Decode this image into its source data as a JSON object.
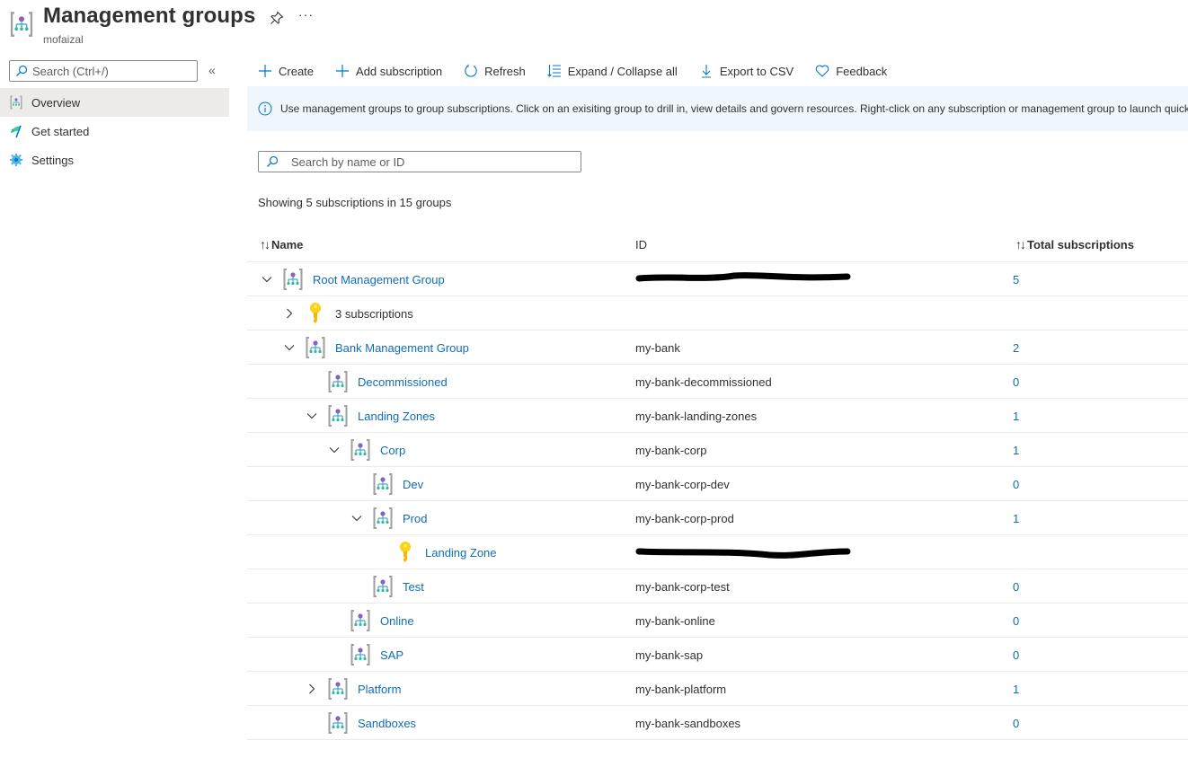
{
  "header": {
    "title": "Management groups",
    "subtitle": "mofaizal",
    "more_label": "···"
  },
  "sidebar": {
    "search_placeholder": "Search (Ctrl+/)",
    "collapse_label": "«",
    "items": [
      {
        "label": "Overview",
        "icon": "management-group-icon",
        "active": true
      },
      {
        "label": "Get started",
        "icon": "flag-icon",
        "active": false
      },
      {
        "label": "Settings",
        "icon": "gear-icon",
        "active": false
      }
    ]
  },
  "toolbar": {
    "create": "Create",
    "add_subscription": "Add subscription",
    "refresh": "Refresh",
    "expand_collapse": "Expand / Collapse all",
    "export_csv": "Export to CSV",
    "feedback": "Feedback"
  },
  "info": {
    "text": "Use management groups to group subscriptions. Click on an exisiting group to drill in, view details and govern resources. Right-click on any subscription or management group to launch quick"
  },
  "filter": {
    "search_placeholder": "Search by name or ID",
    "count_text": "Showing 5 subscriptions in 15 groups"
  },
  "table": {
    "columns": {
      "name": "Name",
      "id": "ID",
      "total": "Total subscriptions",
      "sort_glyph": "↑↓"
    },
    "rows": [
      {
        "name": "Root Management Group",
        "id": "",
        "id_redacted": true,
        "total": "5",
        "type": "group",
        "level": 0,
        "expander": "expanded"
      },
      {
        "name": "3 subscriptions",
        "id": "",
        "id_redacted": false,
        "total": "",
        "type": "subscription-summary",
        "level": 1,
        "expander": "collapsed"
      },
      {
        "name": "Bank Management Group",
        "id": "my-bank",
        "id_redacted": false,
        "total": "2",
        "type": "group",
        "level": 1,
        "expander": "expanded"
      },
      {
        "name": "Decommissioned",
        "id": "my-bank-decommissioned",
        "id_redacted": false,
        "total": "0",
        "type": "group",
        "level": 2,
        "expander": "none"
      },
      {
        "name": "Landing Zones",
        "id": "my-bank-landing-zones",
        "id_redacted": false,
        "total": "1",
        "type": "group",
        "level": 2,
        "expander": "expanded"
      },
      {
        "name": "Corp",
        "id": "my-bank-corp",
        "id_redacted": false,
        "total": "1",
        "type": "group",
        "level": 3,
        "expander": "expanded"
      },
      {
        "name": "Dev",
        "id": "my-bank-corp-dev",
        "id_redacted": false,
        "total": "0",
        "type": "group",
        "level": 4,
        "expander": "none"
      },
      {
        "name": "Prod",
        "id": "my-bank-corp-prod",
        "id_redacted": false,
        "total": "1",
        "type": "group",
        "level": 4,
        "expander": "expanded"
      },
      {
        "name": "Landing Zone",
        "id": "",
        "id_redacted": true,
        "total": "",
        "type": "subscription",
        "level": 5,
        "expander": "none"
      },
      {
        "name": "Test",
        "id": "my-bank-corp-test",
        "id_redacted": false,
        "total": "0",
        "type": "group",
        "level": 4,
        "expander": "none"
      },
      {
        "name": "Online",
        "id": "my-bank-online",
        "id_redacted": false,
        "total": "0",
        "type": "group",
        "level": 3,
        "expander": "none"
      },
      {
        "name": "SAP",
        "id": "my-bank-sap",
        "id_redacted": false,
        "total": "0",
        "type": "group",
        "level": 3,
        "expander": "none"
      },
      {
        "name": "Platform",
        "id": "my-bank-platform",
        "id_redacted": false,
        "total": "1",
        "type": "group",
        "level": 2,
        "expander": "collapsed"
      },
      {
        "name": "Sandboxes",
        "id": "my-bank-sandboxes",
        "id_redacted": false,
        "total": "0",
        "type": "group",
        "level": 2,
        "expander": "none"
      }
    ]
  },
  "colors": {
    "link": "#0f6cbd",
    "accent": "#0078d4",
    "info_bg": "#eff6fc",
    "active_nav_bg": "#edebe9",
    "key_yellow": "#fcd116"
  }
}
